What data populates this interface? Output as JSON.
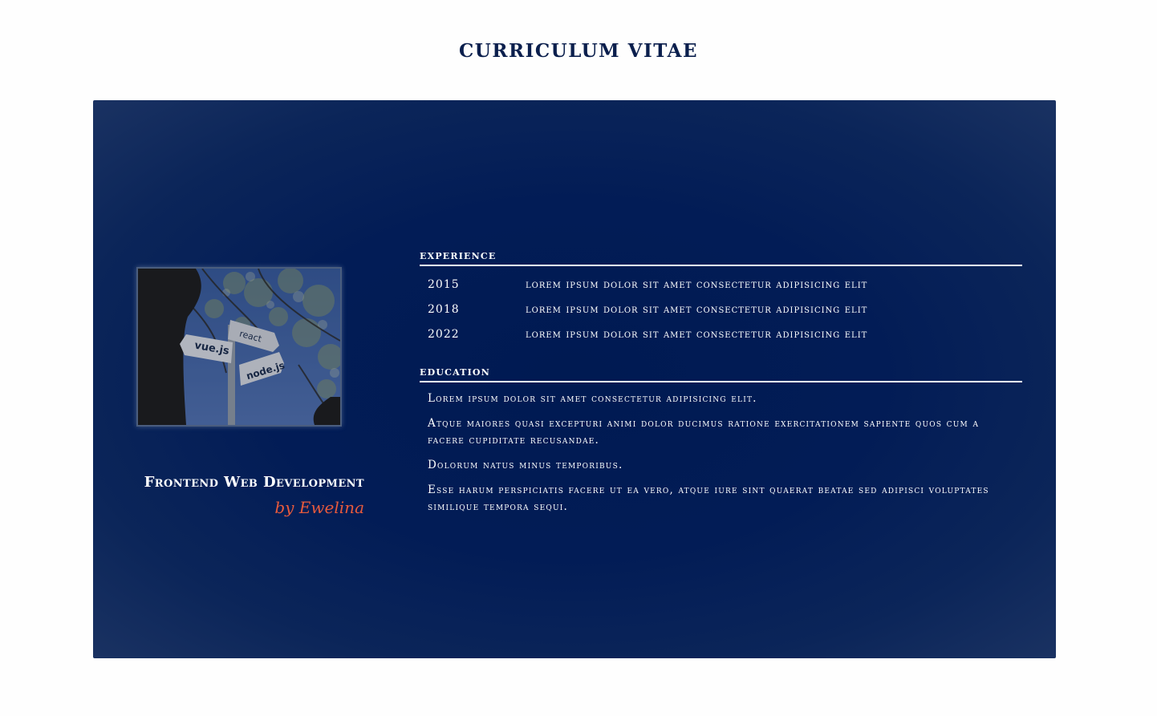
{
  "page": {
    "title": "CURRICULUM VITAE"
  },
  "profile": {
    "photo_icon": "signpost-photo",
    "photo_sign_labels": [
      "vue.js",
      "react",
      "node.js"
    ],
    "role": "Frontend Web Development",
    "author": "by Ewelina"
  },
  "experience": {
    "heading": "experience",
    "items": [
      {
        "year": "2015",
        "text": "Lorem ipsum dolor sit amet consectetur adipisicing elit"
      },
      {
        "year": "2018",
        "text": "Lorem ipsum dolor sit amet consectetur adipisicing elit"
      },
      {
        "year": "2022",
        "text": "Lorem ipsum dolor sit amet consectetur adipisicing elit"
      }
    ]
  },
  "education": {
    "heading": "education",
    "items": [
      "Lorem ipsum dolor sit amet consectetur adipisicing elit.",
      "Atque maiores quasi excepturi animi dolor ducimus ratione exercitationem sapiente quos cum a facere cupiditate recusandae.",
      "Dolorum natus minus temporibus.",
      "Esse harum perspiciatis facere ut ea vero, atque iure sint quaerat beatae sed adipisci voluptates similique tempora sequi."
    ]
  },
  "colors": {
    "page_background": "#fefefe",
    "card_background": "#021c56",
    "title_color": "#0b1f4d",
    "accent": "#e85a3c",
    "text": "#ffffff"
  }
}
